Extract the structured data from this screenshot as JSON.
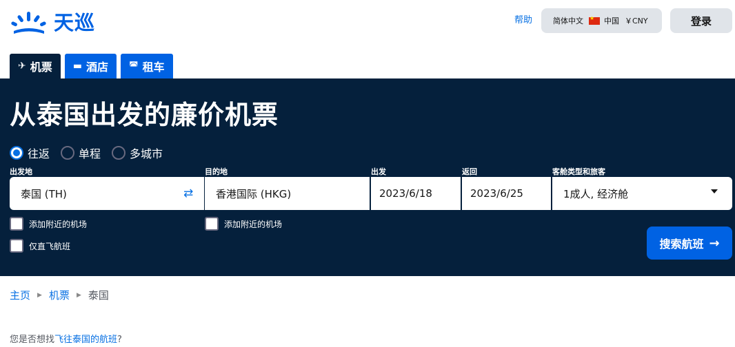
{
  "brand": {
    "name": "天巡",
    "color": "#0062e3"
  },
  "header": {
    "help_label": "帮助",
    "locale": {
      "language": "简体中文",
      "country": "中国",
      "currency": "￥CNY",
      "flag_icon": "china-flag-icon"
    },
    "login_label": "登录"
  },
  "tabs": [
    {
      "label": "机票",
      "icon": "plane-icon",
      "active": true
    },
    {
      "label": "酒店",
      "icon": "bed-icon",
      "active": false
    },
    {
      "label": "租车",
      "icon": "car-icon",
      "active": false
    }
  ],
  "search": {
    "title": "从泰国出发的廉价机票",
    "trip_types": [
      {
        "label": "往返",
        "checked": true
      },
      {
        "label": "单程",
        "checked": false
      },
      {
        "label": "多城市",
        "checked": false
      }
    ],
    "labels": {
      "from": "出发地",
      "to": "目的地",
      "depart": "出发",
      "return": "返回",
      "cabin": "客舱类型和旅客"
    },
    "values": {
      "from": "泰国 (TH)",
      "to": "香港国际 (HKG)",
      "depart": "2023/6/18",
      "return": "2023/6/25",
      "cabin": "1成人, 经济舱"
    },
    "checkboxes": {
      "nearby_from": "添加附近的机场",
      "nearby_to": "添加附近的机场",
      "direct_only": "仅直飞航班"
    },
    "button_label": "搜索航班",
    "colors": {
      "panel": "#05203c",
      "button": "#0062e3"
    }
  },
  "breadcrumb": [
    {
      "label": "主页",
      "link": true
    },
    {
      "label": "机票",
      "link": true
    },
    {
      "label": "泰国",
      "link": false
    }
  ],
  "suggestion": {
    "prefix": "您是否想找",
    "link": "飞往泰国的航班",
    "suffix": "?"
  }
}
